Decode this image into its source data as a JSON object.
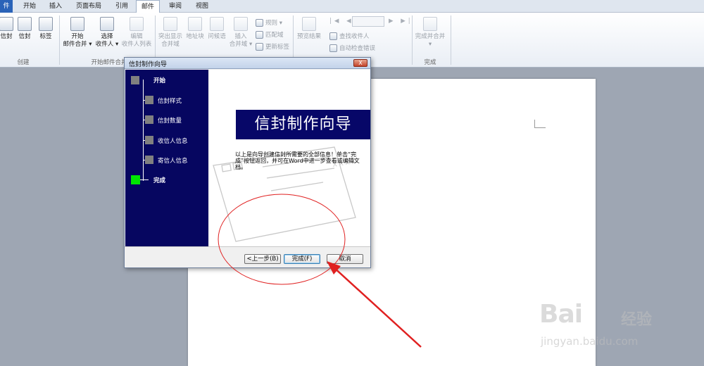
{
  "menubar": {
    "file": "件",
    "tabs": [
      "开始",
      "插入",
      "页面布局",
      "引用",
      "邮件",
      "审阅",
      "视图"
    ],
    "active_tab": "邮件"
  },
  "ribbon": {
    "create_group": {
      "label": "创建",
      "buttons": [
        "信封",
        "信封",
        "标签"
      ]
    },
    "start_merge_group": {
      "label": "开始邮件合并",
      "start": [
        "开始",
        "邮件合并 ▾"
      ],
      "select": [
        "选择",
        "收件人 ▾"
      ],
      "edit": [
        "编辑",
        "收件人列表"
      ]
    },
    "fields_group": {
      "highlight": [
        "突出显示",
        "合并域"
      ],
      "address_block": "地址块",
      "greeting": "问候语",
      "insert": [
        "插入",
        "合并域 ▾"
      ],
      "rules": "规则 ▾",
      "match": "匹配域",
      "update": "更新标签"
    },
    "preview_group": {
      "preview": "预览结果",
      "find": "查找收件人",
      "auto_check": "自动检查错误"
    },
    "finish_group": {
      "label": "完成",
      "finish": [
        "完成并合并",
        "▾"
      ]
    }
  },
  "dialog": {
    "title": "信封制作向导",
    "close": "X",
    "steps": [
      "开始",
      "信封样式",
      "信封数量",
      "收信人信息",
      "寄信人信息",
      "完成"
    ],
    "current_step": "完成",
    "banner": "信封制作向导",
    "description": "以上是向导创建信封所需要的全部信息！单击“完成”按钮返回，并可在Word中进一步查看或编辑文档。",
    "buttons": {
      "back": "<上一步(B)",
      "finish": "完成(F)",
      "cancel": "取消"
    }
  },
  "watermark": {
    "logo": "Bai",
    "logo_cn": "经验",
    "url": "jingyan.baidu.com"
  },
  "colors": {
    "wizard_nav": "#060660",
    "current_step": "#00e600",
    "annotation": "#e02020",
    "file_tab": "#2a63b8"
  }
}
